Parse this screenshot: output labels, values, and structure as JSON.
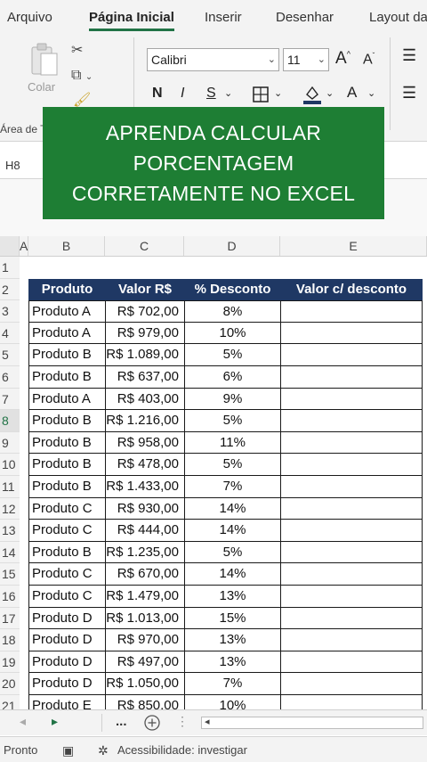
{
  "ribbon_tabs": [
    {
      "label": "Arquivo"
    },
    {
      "label": "Página Inicial"
    },
    {
      "label": "Inserir"
    },
    {
      "label": "Desenhar"
    },
    {
      "label": "Layout da"
    }
  ],
  "ribbon": {
    "paste_label": "Colar",
    "clipboard_group_label": "Área de T",
    "font_name": "Calibri",
    "font_size": "11",
    "bold_label": "N",
    "italic_label": "I",
    "underline_label": "S",
    "grow_font_label": "A",
    "shrink_font_label": "A",
    "font_color_label": "A"
  },
  "name_box": "H8",
  "banner": {
    "line1": "APRENDA CALCULAR",
    "line2": "PORCENTAGEM",
    "line3": "CORRETAMENTE NO EXCEL",
    "color": "#1e7e34"
  },
  "columns": [
    "A",
    "B",
    "C",
    "D",
    "E"
  ],
  "row_numbers": [
    "1",
    "2",
    "3",
    "4",
    "5",
    "6",
    "7",
    "8",
    "9",
    "10",
    "11",
    "12",
    "13",
    "14",
    "15",
    "16",
    "17",
    "18",
    "19",
    "20",
    "21"
  ],
  "table": {
    "headers": [
      "Produto",
      "Valor R$",
      "% Desconto",
      "Valor c/ desconto"
    ],
    "header_color": "#1f3864",
    "rows": [
      [
        "Produto A",
        "R$ 702,00",
        "8%",
        ""
      ],
      [
        "Produto A",
        "R$ 979,00",
        "10%",
        ""
      ],
      [
        "Produto B",
        "R$ 1.089,00",
        "5%",
        ""
      ],
      [
        "Produto B",
        "R$ 637,00",
        "6%",
        ""
      ],
      [
        "Produto A",
        "R$ 403,00",
        "9%",
        ""
      ],
      [
        "Produto B",
        "R$ 1.216,00",
        "5%",
        ""
      ],
      [
        "Produto B",
        "R$ 958,00",
        "11%",
        ""
      ],
      [
        "Produto B",
        "R$ 478,00",
        "5%",
        ""
      ],
      [
        "Produto B",
        "R$ 1.433,00",
        "7%",
        ""
      ],
      [
        "Produto C",
        "R$ 930,00",
        "14%",
        ""
      ],
      [
        "Produto C",
        "R$ 444,00",
        "14%",
        ""
      ],
      [
        "Produto B",
        "R$ 1.235,00",
        "5%",
        ""
      ],
      [
        "Produto C",
        "R$ 670,00",
        "14%",
        ""
      ],
      [
        "Produto C",
        "R$ 1.479,00",
        "13%",
        ""
      ],
      [
        "Produto D",
        "R$ 1.013,00",
        "15%",
        ""
      ],
      [
        "Produto D",
        "R$ 970,00",
        "13%",
        ""
      ],
      [
        "Produto D",
        "R$ 497,00",
        "13%",
        ""
      ],
      [
        "Produto D",
        "R$ 1.050,00",
        "7%",
        ""
      ],
      [
        "Produto E",
        "R$ 850,00",
        "10%",
        ""
      ]
    ]
  },
  "sheet_nav": {
    "more_label": "..."
  },
  "status": {
    "ready": "Pronto",
    "accessibility": "Acessibilidade: investigar"
  },
  "accent_color": "#217346"
}
